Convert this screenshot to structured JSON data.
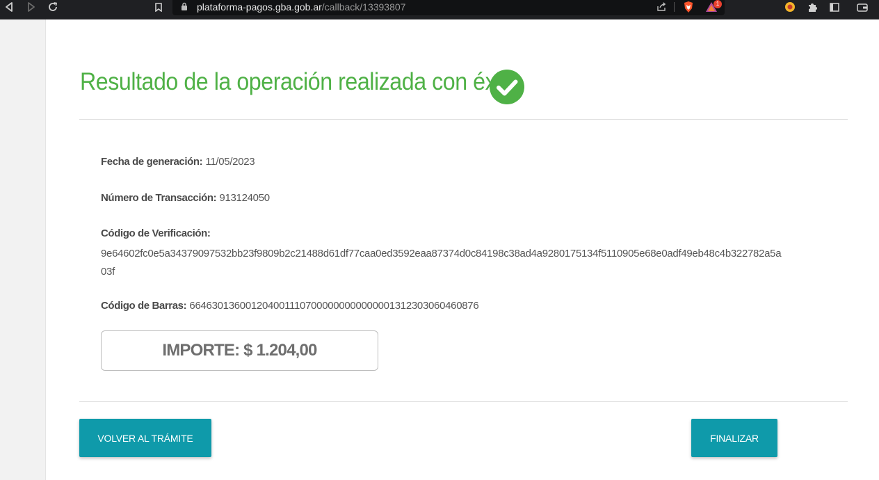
{
  "browser": {
    "url_host": "plataforma-pagos.gba.gob.ar",
    "url_path": "/callback/13393807",
    "notification_badge": "1"
  },
  "page": {
    "title": "Resultado de la operación realizada con éxito",
    "fields": {
      "fecha_label": "Fecha de generación:",
      "fecha_value": "11/05/2023",
      "transaccion_label": "Número de Transacción:",
      "transaccion_value": "913124050",
      "verificacion_label": "Código de Verificación:",
      "verificacion_value": "9e64602fc0e5a34379097532bb23f9809b2c21488d61df77caa0ed3592eaa87374d0c84198c38ad4a9280175134f5110905e68e0adf49eb48c4b322782a5a03f",
      "barras_label": "Código de Barras:",
      "barras_value": "6646301360012040011107000000000000001312303060460876"
    },
    "importe": "IMPORTE: $ 1.204,00",
    "buttons": {
      "volver": "VOLVER AL TRÁMITE",
      "finalizar": "FINALIZAR"
    }
  },
  "colors": {
    "success_green": "#4fb146",
    "button_teal": "#0f9aaa"
  }
}
